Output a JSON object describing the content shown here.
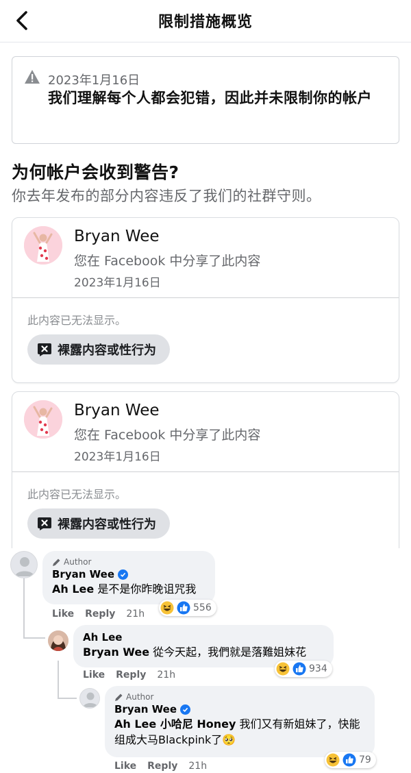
{
  "header": {
    "title": "限制措施概览"
  },
  "notice": {
    "date": "2023年1月16日",
    "message": "我们理解每个人都会犯错，因此并未限制你的帐户"
  },
  "why": {
    "heading": "为何帐户会收到警告?",
    "subtext": "你去年发布的部分内容违反了我们的社群守则。"
  },
  "posts": [
    {
      "name": "Bryan Wee",
      "shared": "您在 Facebook 中分享了此内容",
      "date": "2023年1月16日",
      "unavailable": "此内容已无法显示。",
      "reason": "裸露内容或性行为"
    },
    {
      "name": "Bryan Wee",
      "shared": "您在 Facebook 中分享了此内容",
      "date": "2023年1月16日",
      "unavailable": "此内容已无法显示。",
      "reason": "裸露内容或性行为"
    }
  ],
  "comments": [
    {
      "author_tag": "Author",
      "name": "Bryan Wee",
      "verified": true,
      "mention": "Ah Lee",
      "text": " 是不是你昨晚诅咒我",
      "like": "Like",
      "reply": "Reply",
      "time": "21h",
      "reaction_count": "556"
    },
    {
      "name": "Ah Lee",
      "mention": "Bryan Wee",
      "text": " 從今天起，我們就是落難姐妹花",
      "like": "Like",
      "reply": "Reply",
      "time": "21h",
      "reaction_count": "934"
    },
    {
      "author_tag": "Author",
      "name": "Bryan Wee",
      "verified": true,
      "mention": "Ah Lee 小哈尼 Honey",
      "text": " 我们又有新姐妹了，快能组成大马Blackpink了",
      "trailing_emoji": "🥺",
      "like": "Like",
      "reply": "Reply",
      "time": "21h",
      "reaction_count": "79"
    }
  ],
  "icons": {
    "back": "chevron-left-icon",
    "warning": "warning-triangle-icon",
    "reason": "x-speech-bubble-icon",
    "author": "pencil-icon",
    "verified": "verified-badge-icon",
    "reactions": [
      "haha-reaction-icon",
      "like-reaction-icon"
    ]
  },
  "colors": {
    "facebook_blue": "#1877f2",
    "secondary_text": "#65676b",
    "chip_bg": "#dfe1e5",
    "bubble_bg": "#f0f2f5"
  }
}
